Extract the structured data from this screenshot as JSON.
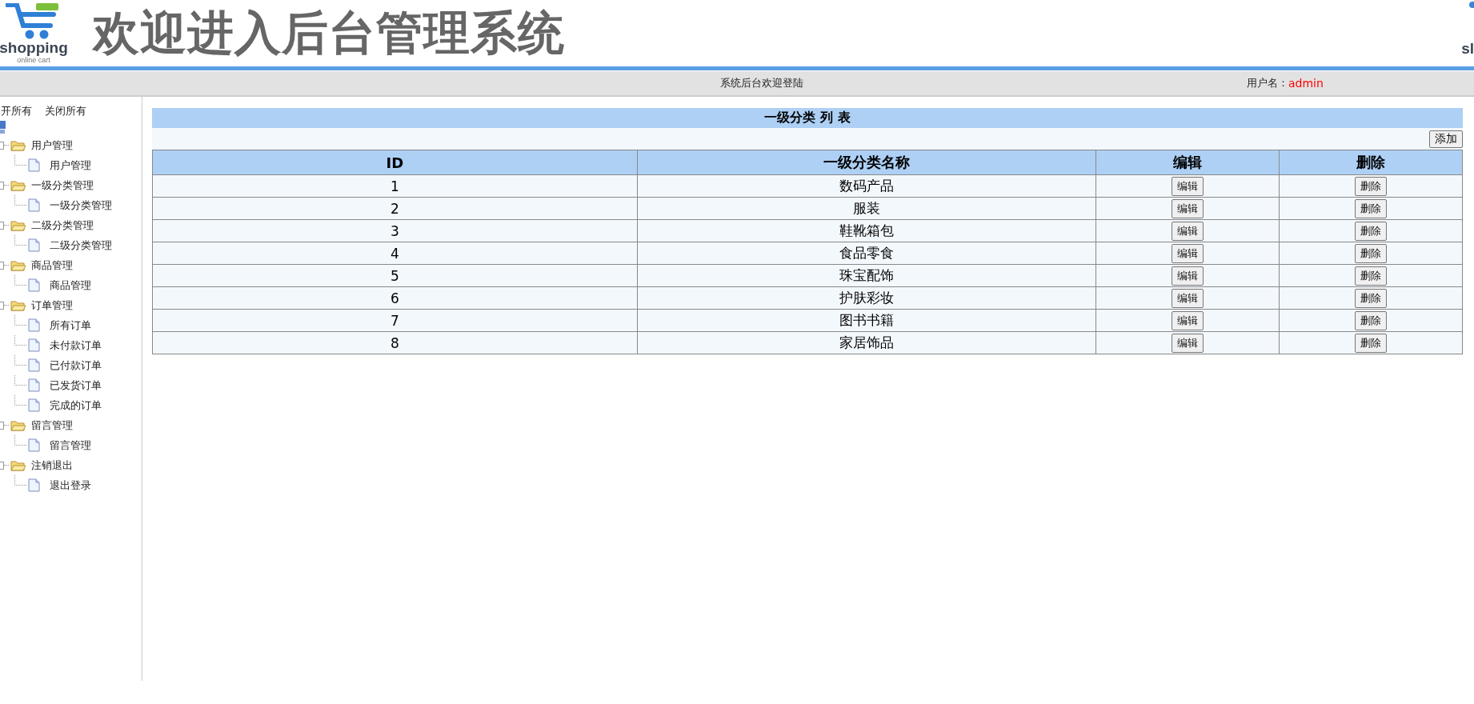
{
  "header": {
    "logo_text": "shopping",
    "logo_subtext": "online cart",
    "title": "欢迎进入后台管理系统",
    "logo_right_text": "sl"
  },
  "top_bar": {
    "welcome": "系统后台欢迎登陆",
    "user_label": "用户名：",
    "user_name": "admin"
  },
  "sidebar": {
    "expand_all": "开所有",
    "collapse_all": "关闭所有",
    "tree": [
      {
        "label": "用户管理",
        "expanded": true,
        "children": [
          {
            "label": "用户管理"
          }
        ]
      },
      {
        "label": "一级分类管理",
        "expanded": true,
        "children": [
          {
            "label": "一级分类管理"
          }
        ]
      },
      {
        "label": "二级分类管理",
        "expanded": true,
        "children": [
          {
            "label": "二级分类管理"
          }
        ]
      },
      {
        "label": "商品管理",
        "expanded": true,
        "children": [
          {
            "label": "商品管理"
          }
        ]
      },
      {
        "label": "订单管理",
        "expanded": true,
        "children": [
          {
            "label": "所有订单"
          },
          {
            "label": "未付款订单"
          },
          {
            "label": "已付款订单"
          },
          {
            "label": "已发货订单"
          },
          {
            "label": "完成的订单"
          }
        ]
      },
      {
        "label": "留言管理",
        "expanded": true,
        "children": [
          {
            "label": "留言管理"
          }
        ]
      },
      {
        "label": "注销退出",
        "expanded": true,
        "children": [
          {
            "label": "退出登录"
          }
        ]
      }
    ]
  },
  "table": {
    "title": "一级分类 列 表",
    "add_button": "添加",
    "columns": [
      "ID",
      "一级分类名称",
      "编辑",
      "删除"
    ],
    "rows": [
      {
        "id": "1",
        "name": "数码产品",
        "edit": "编辑",
        "delete": "删除"
      },
      {
        "id": "2",
        "name": "服装",
        "edit": "编辑",
        "delete": "删除"
      },
      {
        "id": "3",
        "name": "鞋靴箱包",
        "edit": "编辑",
        "delete": "删除"
      },
      {
        "id": "4",
        "name": "食品零食",
        "edit": "编辑",
        "delete": "删除"
      },
      {
        "id": "5",
        "name": "珠宝配饰",
        "edit": "编辑",
        "delete": "删除"
      },
      {
        "id": "6",
        "name": "护肤彩妆",
        "edit": "编辑",
        "delete": "删除"
      },
      {
        "id": "7",
        "name": "图书书籍",
        "edit": "编辑",
        "delete": "删除"
      },
      {
        "id": "8",
        "name": "家居饰品",
        "edit": "编辑",
        "delete": "删除"
      }
    ]
  }
}
